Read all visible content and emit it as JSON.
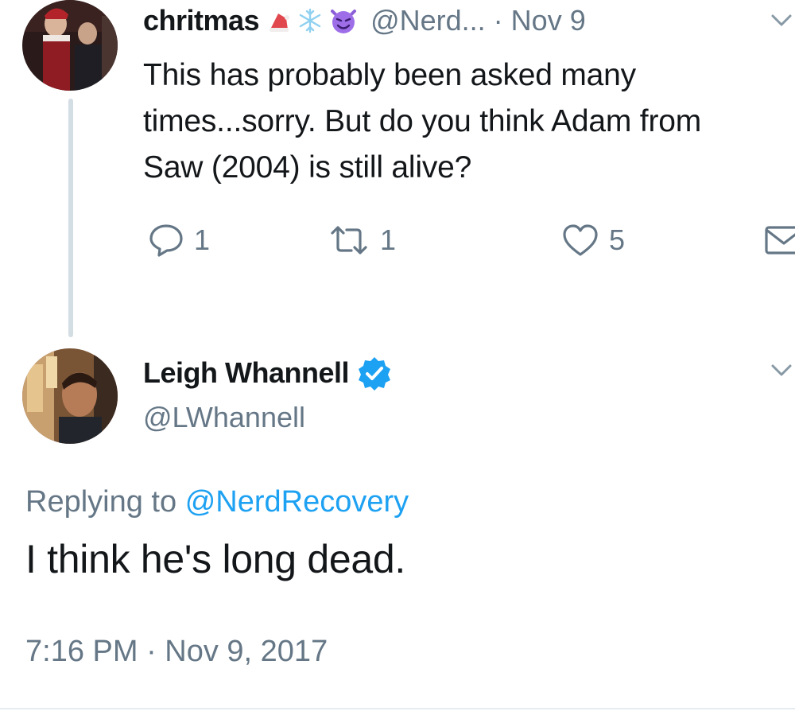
{
  "parent_tweet": {
    "display_name": "chritmas",
    "name_emojis": [
      "santa-hat-emoji-icon",
      "snowflake-emoji-icon",
      "smiling-devil-emoji-icon"
    ],
    "handle": "@Nerd...",
    "separator": "·",
    "date": "Nov 9",
    "text": "This has probably been asked many times...sorry. But do you think Adam from Saw (2004) is still alive?",
    "actions": {
      "reply_count": "1",
      "retweet_count": "1",
      "like_count": "5"
    }
  },
  "reply_tweet": {
    "display_name": "Leigh Whannell",
    "verified": true,
    "handle": "@LWhannell",
    "replying_prefix": "Replying to",
    "replying_mention": "@NerdRecovery",
    "text": "I think he's long dead.",
    "timestamp": "7:16 PM · Nov 9, 2017"
  },
  "colors": {
    "text_primary": "#14171a",
    "text_secondary": "#657786",
    "link": "#1da1f2",
    "verified_badge": "#1da1f2",
    "thread_line": "#d3dde4"
  }
}
